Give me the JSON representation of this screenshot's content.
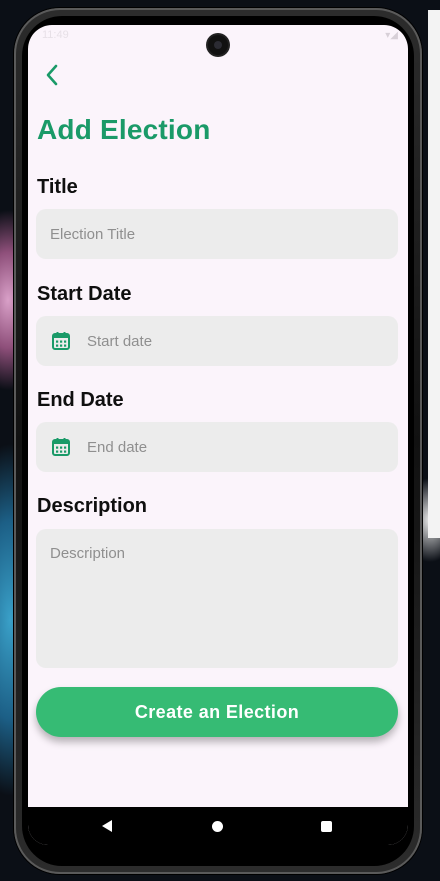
{
  "status_bar": {
    "time": "11:49",
    "icons": "▾◢"
  },
  "header": {
    "title": "Add Election"
  },
  "form": {
    "title": {
      "label": "Title",
      "placeholder": "Election Title"
    },
    "start_date": {
      "label": "Start Date",
      "placeholder": "Start date"
    },
    "end_date": {
      "label": "End Date",
      "placeholder": "End date"
    },
    "description": {
      "label": "Description",
      "placeholder": "Description"
    },
    "submit_label": "Create an Election"
  },
  "colors": {
    "accent": "#1a9a68",
    "button": "#36bb74",
    "field_bg": "#ececec",
    "screen_bg": "#fbf4fb"
  }
}
